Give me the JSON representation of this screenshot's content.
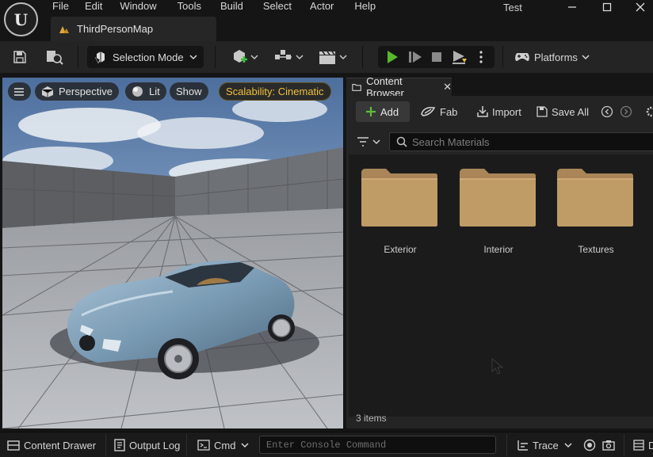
{
  "app": {
    "logo_letter": "U",
    "window_title": "Test",
    "menu": [
      "File",
      "Edit",
      "Window",
      "Tools",
      "Build",
      "Select",
      "Actor",
      "Help"
    ],
    "project_tab": "ThirdPersonMap",
    "window_controls": [
      "minimize-icon",
      "maximize-icon",
      "close-icon"
    ]
  },
  "toolbar": {
    "save_icon": "save-icon",
    "browse_icon": "browse-icon",
    "mode_label": "Selection Mode",
    "add_actor_icon": "add-actor-icon",
    "snap_icon": "snap-icon",
    "cinematics_icon": "clapper-icon",
    "play_controls": [
      "play-icon",
      "step-icon",
      "stop-icon",
      "eject-icon",
      "more-icon"
    ],
    "platforms_label": "Platforms"
  },
  "viewport": {
    "menu_icon": "hamburger-icon",
    "perspective_label": "Perspective",
    "lit_label": "Lit",
    "show_label": "Show",
    "scalability_label": "Scalability: Cinematic",
    "scene": "blue convertible sports car in a grey tiled courtyard under a cloudy sky"
  },
  "content_browser": {
    "tab_label": "Content Browser",
    "close_glyph": "✕",
    "add_label": "Add",
    "fab_label": "Fab",
    "import_label": "Import",
    "save_all_label": "Save All",
    "search_placeholder": "Search Materials",
    "folders": [
      {
        "name": "Exterior"
      },
      {
        "name": "Interior"
      },
      {
        "name": "Textures"
      }
    ],
    "item_count": "3 items",
    "folder_color": "#bf9b66"
  },
  "statusbar": {
    "content_drawer_label": "Content Drawer",
    "output_log_label": "Output Log",
    "cmd_label": "Cmd",
    "console_placeholder": "Enter Console Command",
    "trace_label": "Trace",
    "end_label": "D"
  }
}
